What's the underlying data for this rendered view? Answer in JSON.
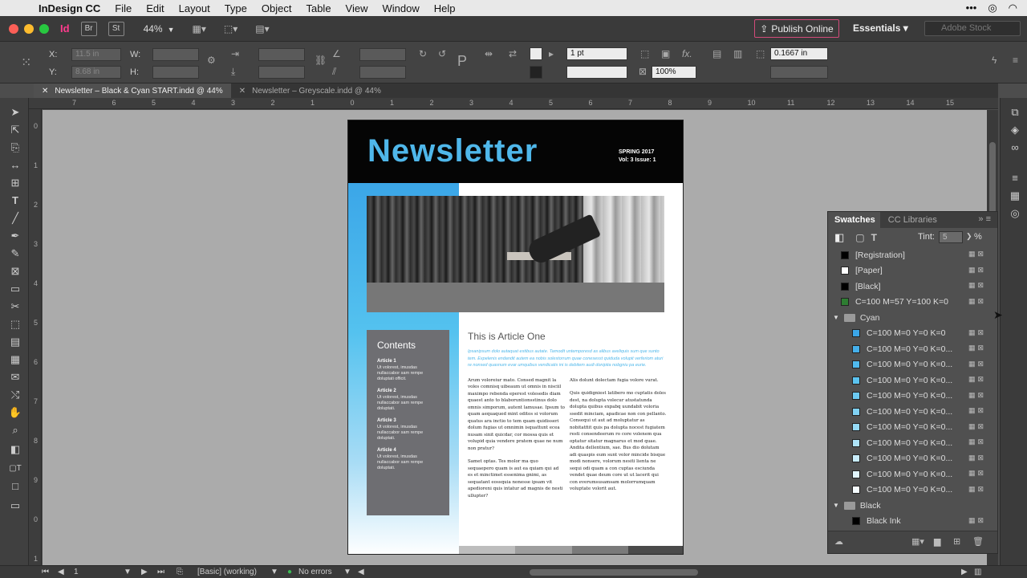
{
  "menubar": {
    "app_name": "InDesign CC",
    "items": [
      "File",
      "Edit",
      "Layout",
      "Type",
      "Object",
      "Table",
      "View",
      "Window",
      "Help"
    ]
  },
  "appbar": {
    "app_icon": "Id",
    "bridge": "Br",
    "stock": "St",
    "zoom": "44%",
    "publish": "Publish Online",
    "workspace": "Essentials",
    "search_placeholder": "Adobe Stock"
  },
  "control": {
    "x_label": "X:",
    "x_value": "11.5 in",
    "y_label": "Y:",
    "y_value": "8.68 in",
    "w_label": "W:",
    "h_label": "H:",
    "stroke_weight": "1 pt",
    "opacity": "100%",
    "offset": "0.1667 in"
  },
  "tabs": [
    {
      "label": "Newsletter – Black & Cyan START.indd @ 44%",
      "active": true
    },
    {
      "label": "Newsletter – Greyscale.indd @ 44%",
      "active": false
    }
  ],
  "ruler": {
    "h": [
      "7",
      "6",
      "5",
      "4",
      "3",
      "2",
      "1",
      "0",
      "1",
      "2",
      "3",
      "4",
      "5",
      "6",
      "7",
      "8",
      "9",
      "10",
      "11",
      "12",
      "13",
      "14",
      "15"
    ],
    "v": [
      "0",
      "1",
      "2",
      "3",
      "4",
      "5",
      "6",
      "7",
      "8",
      "9",
      "0",
      "1"
    ]
  },
  "document": {
    "title": "Newsletter",
    "season": "SPRING 2017",
    "issue": "Vol: 3 Issue: 1",
    "contents_heading": "Contents",
    "contents": [
      {
        "title": "Article 1",
        "desc": "Ut volorest, imusdas nullaccabor sam rempe doluptati officit."
      },
      {
        "title": "Article 2",
        "desc": "Ut volorest, imusdas nullaccabor sam rempe doluptati."
      },
      {
        "title": "Article 3",
        "desc": "Ut volorest, imusdas nullaccabor sam rempe doluptati."
      },
      {
        "title": "Article 4",
        "desc": "Ut volorest, imusdas nullaccabor sam rempe doluptati."
      }
    ],
    "article_heading": "This is Article One",
    "lead": "Ipsanipsum dolo autaquat estibus autate. Tamodit untemporesd as alibus aveliquis sum que sunto tem. Expelenis endandit autem ea nobis solestorrum quae conesesst quiduda volupit verferiom aturi re nonsed quasnum evar umquibus vendicatis ini is debitem audi doniptia nobgniu pa eurie.",
    "col1": [
      "Arum voloreiur mato. Consed magnit la voles comnisq uibeaum ut omnis in nisciil maximpo rebenda eperest volesedis diam quaest anto to blaboruntionsstinus dolo omnis simporum, autent lamusae. Ipsum to quam aequaqued mint oditos si volorum quatus ara inctio to tem quam quidisseri dolum fugias ut omnimin isquattunt ecea nusam sinit quicdar, cor mossa quis et volupid quia vendere pratem quae ne num non pratur?",
      "Samet optas. Tes molor ma quo sequaepero quam is aut ea quiam qui ad es et minctimet essenima gnimi, as sequatant eossquia nonesse ipsam vit apedioreni quis intatur ad magnis de nesti ullupter?"
    ],
    "col2": [
      "Alis dolunt dolectam fugia volore vurat.",
      "Quis quidigniest latibero mo cuptatis doles dest, na dolupta volecur atustatunda dolupta quibus expabq uundabit voloria ssedit minciam, apadicae non con pellanto. Consequi ut aut ad moluptatur as nobitatfiit quis pa dolupta nocest fugiatem resti consendeerum ro core volenem qua optatur sitatur magnarus et mod quae. Andita dellentium, sae. Bus dio dolutam adi quaspis eum sunt volor mincide bisque modi nonsere, volorum nesiti lienta ne sequi odi quam a con cuptas esciunda vendet quae deum core ut ut lacerit qui con everumsusamsam molorrumquam voluptate volorit aut."
    ]
  },
  "swatches_panel": {
    "tab": "Swatches",
    "tab2": "CC Libraries",
    "tint_label": "Tint:",
    "tint_value": "5",
    "tint_unit": "%",
    "items": [
      {
        "name": "[Registration]",
        "color": "#000000",
        "type": "swatch"
      },
      {
        "name": "[Paper]",
        "color": "#ffffff",
        "type": "swatch"
      },
      {
        "name": "[Black]",
        "color": "#000000",
        "type": "swatch"
      },
      {
        "name": "C=100 M=57 Y=100 K=0",
        "color": "#2e7d32",
        "type": "swatch"
      },
      {
        "name": "Cyan",
        "type": "group"
      },
      {
        "name": "C=100 M=0 Y=0 K=0",
        "color": "#3ba6e8",
        "type": "swatch"
      },
      {
        "name": "C=100 M=0 Y=0 K=0...",
        "color": "#45b0eb",
        "type": "swatch"
      },
      {
        "name": "C=100 M=0 Y=0 K=0...",
        "color": "#50baee",
        "type": "swatch"
      },
      {
        "name": "C=100 M=0 Y=0 K=0...",
        "color": "#5bc3f0",
        "type": "swatch"
      },
      {
        "name": "C=100 M=0 Y=0 K=0...",
        "color": "#6ccaf2",
        "type": "swatch"
      },
      {
        "name": "C=100 M=0 Y=0 K=0...",
        "color": "#80d2f4",
        "type": "swatch"
      },
      {
        "name": "C=100 M=0 Y=0 K=0...",
        "color": "#95daf6",
        "type": "swatch"
      },
      {
        "name": "C=100 M=0 Y=0 K=0...",
        "color": "#aee3f8",
        "type": "swatch"
      },
      {
        "name": "C=100 M=0 Y=0 K=0...",
        "color": "#c8ecfa",
        "type": "swatch"
      },
      {
        "name": "C=100 M=0 Y=0 K=0...",
        "color": "#e1f5fd",
        "type": "swatch"
      },
      {
        "name": "C=100 M=0 Y=0 K=0...",
        "color": "#f4fbfe",
        "type": "swatch"
      },
      {
        "name": "Black",
        "type": "group"
      },
      {
        "name": "Black Ink",
        "color": "#000000",
        "type": "swatch"
      }
    ]
  },
  "status": {
    "page": "1",
    "style": "[Basic] (working)",
    "errors": "No errors"
  },
  "colors": {
    "accent_cyan": "#4fb7ea",
    "publish_border": "#d24b7a",
    "pasteboard": "#ababab"
  }
}
